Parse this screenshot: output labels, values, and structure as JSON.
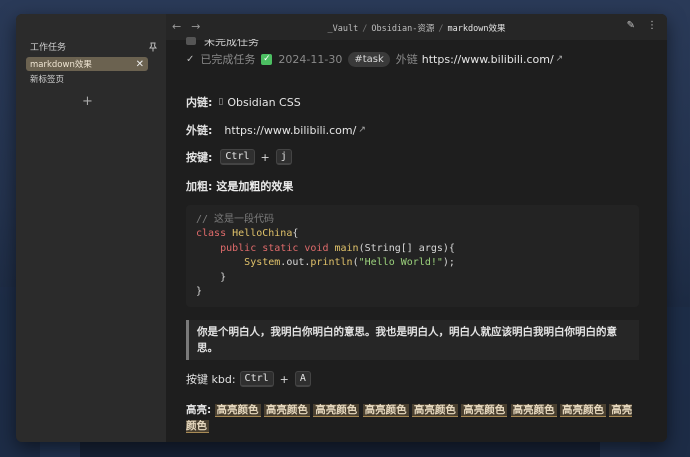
{
  "sidebar": {
    "title": "工作任务",
    "tabs": [
      {
        "label": "markdown效果",
        "active": true
      },
      {
        "label": "新标签页",
        "active": false
      }
    ]
  },
  "topbar": {
    "crumbs": [
      "_Vault",
      "Obsidian-资源",
      "markdown效果"
    ]
  },
  "tasks": {
    "incomplete_label": "未完成任务",
    "done_label": "已完成任务",
    "done_date": "2024-11-30",
    "tag": "#task",
    "ext_label": "外链",
    "ext_url": "https://www.bilibili.com/"
  },
  "internal_link": {
    "label": "内链:",
    "target": "Obsidian CSS"
  },
  "external_link": {
    "label": "外链:",
    "url": "https://www.bilibili.com/"
  },
  "keys": {
    "label": "按键:",
    "k1": "Ctrl",
    "plus": "+",
    "k2": "j"
  },
  "bold": {
    "label": "加粗:",
    "text": "这是加粗的效果"
  },
  "code": {
    "comment": "// 这是一段代码",
    "l2_kw": "class",
    "l2_name": "HelloChina",
    "l2_rest": "{",
    "l3_kw": "public static void",
    "l3_fn": "main",
    "l3_rest": "(String[] args){",
    "l4_obj": "System",
    "l4_mid": ".out.",
    "l4_fn": "println",
    "l4_open": "(",
    "l4_str": "\"Hello World!\"",
    "l4_close": ");",
    "l5": "}",
    "l6": "}"
  },
  "quote": {
    "text": "你是个明白人，我明白你明白的意思。我也是明白人，明白人就应该明白我明白你明白的意思。"
  },
  "kbd2": {
    "label": "按键 kbd:",
    "k1": "Ctrl",
    "plus": "+",
    "k2": "A"
  },
  "highlight": {
    "label": "高亮:",
    "items": [
      "高亮颜色",
      "高亮颜色",
      "高亮颜色",
      "高亮颜色",
      "高亮颜色",
      "高亮颜色",
      "高亮颜色",
      "高亮颜色",
      "高亮颜色"
    ]
  }
}
